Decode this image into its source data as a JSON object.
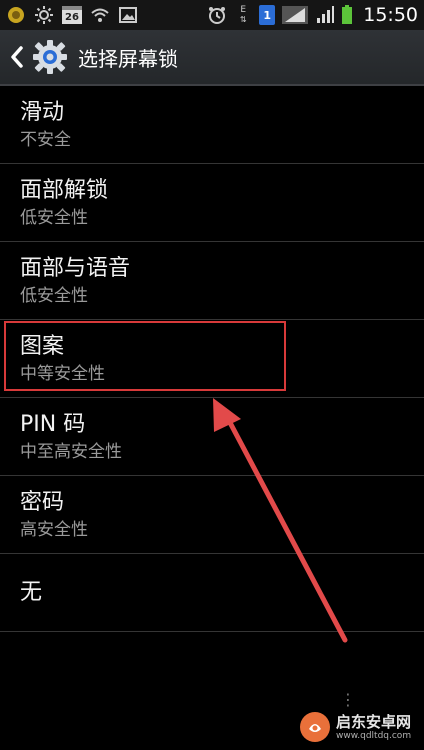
{
  "status_bar": {
    "calendar_day": "26",
    "sim_label": "1",
    "network_label": "E",
    "time": "15:50",
    "icons": [
      "app-icon",
      "sun-icon",
      "calendar-icon",
      "wifi-icon",
      "image-icon",
      "alarm-icon",
      "data-icon",
      "sim-icon",
      "signal-icon",
      "battery-icon"
    ]
  },
  "action_bar": {
    "title": "选择屏幕锁"
  },
  "list": {
    "items": [
      {
        "title": "滑动",
        "subtitle": "不安全"
      },
      {
        "title": "面部解锁",
        "subtitle": "低安全性"
      },
      {
        "title": "面部与语音",
        "subtitle": "低安全性"
      },
      {
        "title": "图案",
        "subtitle": "中等安全性"
      },
      {
        "title": "PIN 码",
        "subtitle": "中至高安全性"
      },
      {
        "title": "密码",
        "subtitle": "高安全性"
      },
      {
        "title": "无",
        "subtitle": ""
      }
    ]
  },
  "watermark": {
    "name": "启东安卓网",
    "url": "www.qdltdq.com"
  },
  "colors": {
    "highlight": "#d83a3a",
    "arrow": "#e24a4a",
    "accent": "#2b6dd6",
    "battery": "#5cc43a"
  }
}
